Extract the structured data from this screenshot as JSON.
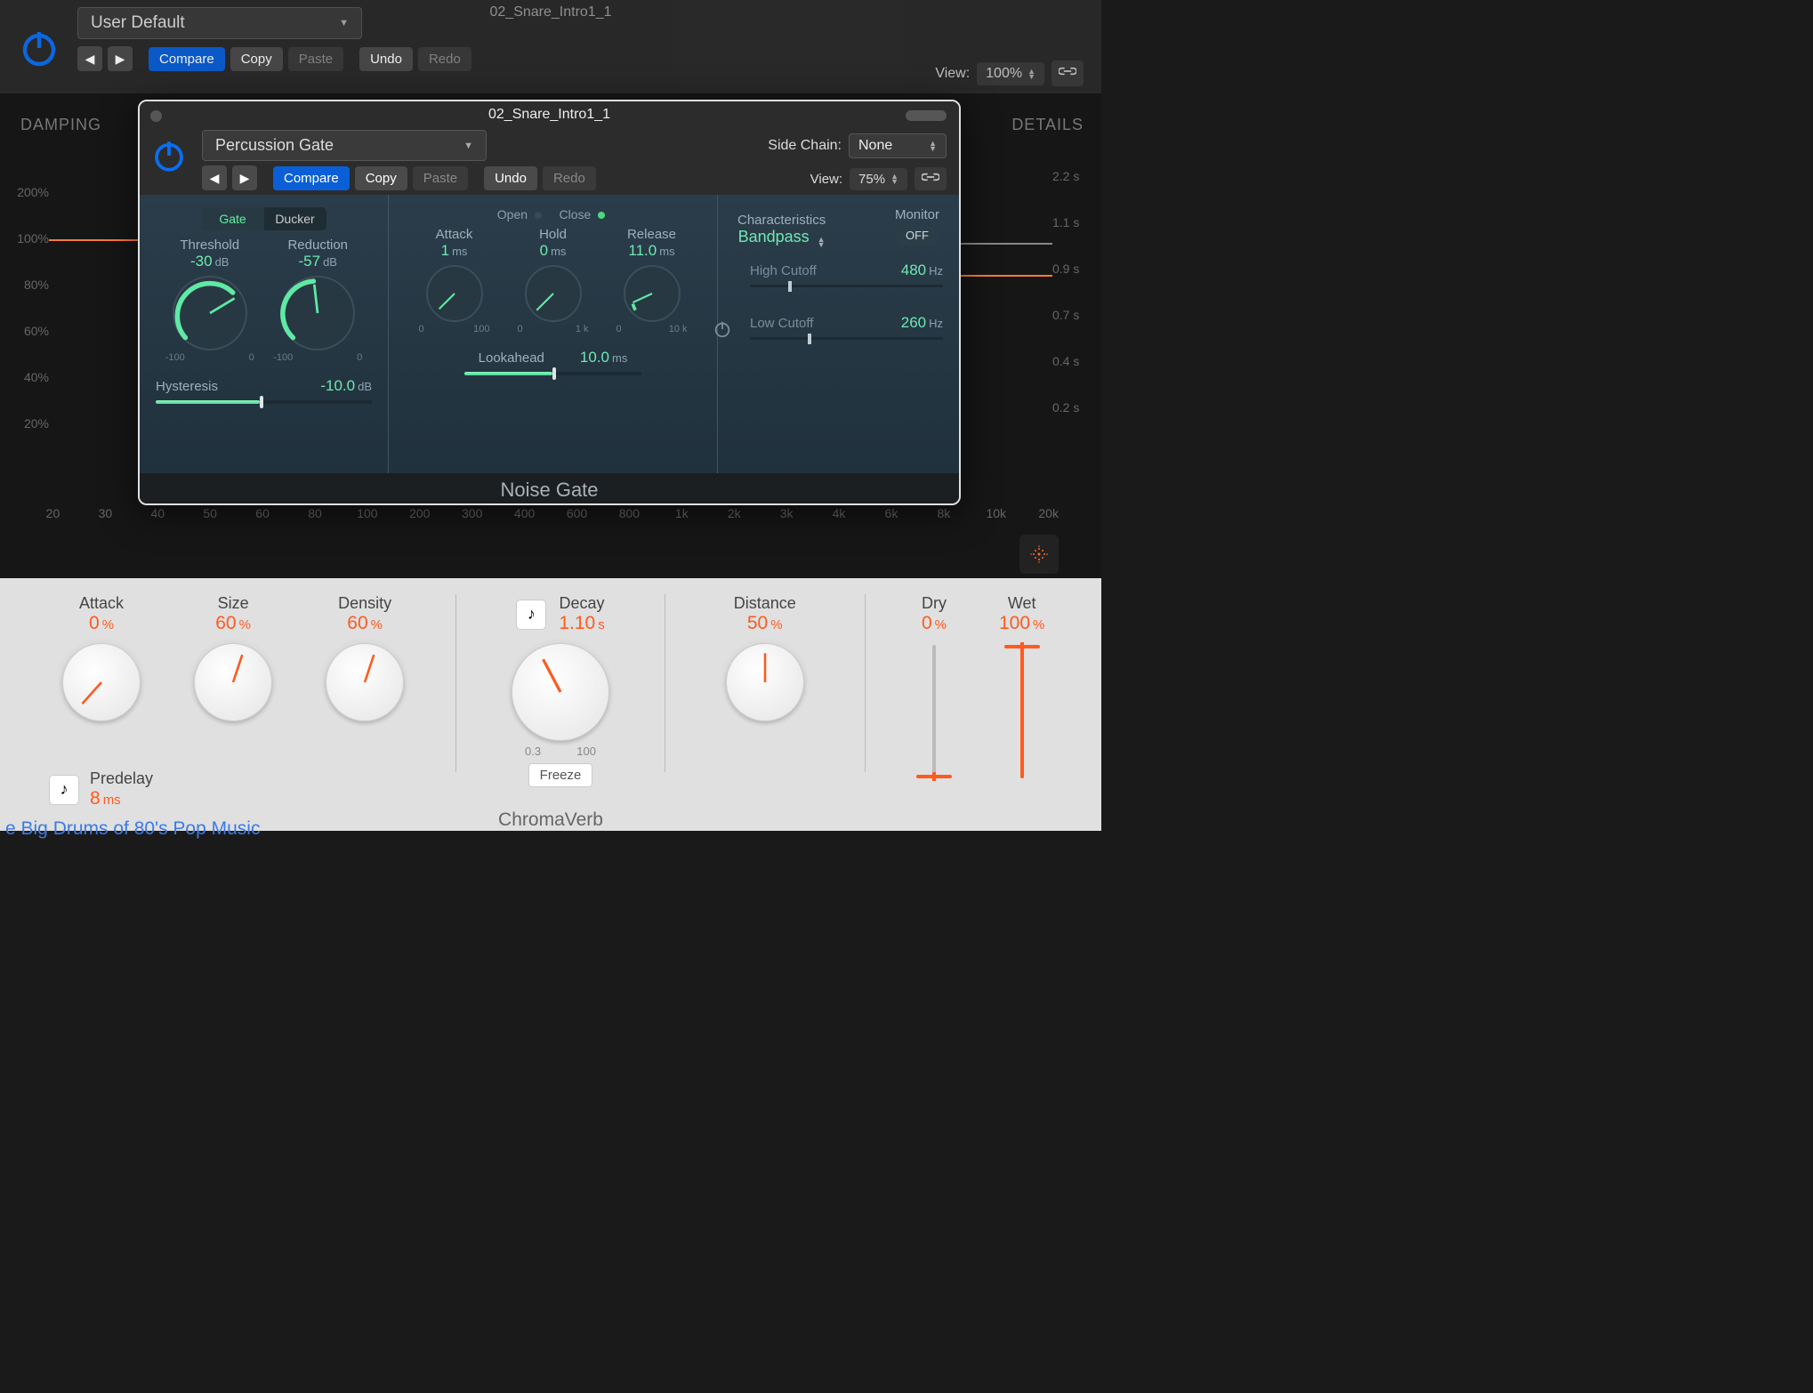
{
  "outer": {
    "tab_title": "02_Snare_Intro1_1",
    "preset": "User Default",
    "compare": "Compare",
    "copy": "Copy",
    "paste": "Paste",
    "undo": "Undo",
    "redo": "Redo",
    "view_label": "View:",
    "view_pct": "100%"
  },
  "graph": {
    "damping": "DAMPING",
    "details": "DETAILS",
    "y_left": [
      "200%",
      "100%",
      "80%",
      "60%",
      "40%",
      "20%"
    ],
    "y_right": [
      "2.2 s",
      "1.1 s",
      "0.9 s",
      "0.7 s",
      "0.4 s",
      "0.2 s"
    ],
    "x": [
      "20",
      "30",
      "40",
      "50",
      "60",
      "80",
      "100",
      "200",
      "300",
      "400",
      "600",
      "800",
      "1k",
      "2k",
      "3k",
      "4k",
      "6k",
      "8k",
      "10k",
      "20k"
    ]
  },
  "ng": {
    "title": "02_Snare_Intro1_1",
    "preset": "Percussion Gate",
    "sidechain_label": "Side Chain:",
    "sidechain_value": "None",
    "compare": "Compare",
    "copy": "Copy",
    "paste": "Paste",
    "undo": "Undo",
    "redo": "Redo",
    "view_label": "View:",
    "view_pct": "75%",
    "tabs": {
      "gate": "Gate",
      "ducker": "Ducker"
    },
    "open": "Open",
    "close": "Close",
    "threshold": {
      "label": "Threshold",
      "val": "-30",
      "unit": "dB",
      "lo": "-100",
      "hi": "0"
    },
    "reduction": {
      "label": "Reduction",
      "val": "-57",
      "unit": "dB",
      "lo": "-100",
      "hi": "0"
    },
    "attack": {
      "label": "Attack",
      "val": "1",
      "unit": "ms",
      "lo": "0",
      "hi": "100"
    },
    "hold": {
      "label": "Hold",
      "val": "0",
      "unit": "ms",
      "lo": "0",
      "hi": "1 k"
    },
    "release": {
      "label": "Release",
      "val": "11.0",
      "unit": "ms",
      "lo": "0",
      "hi": "10 k"
    },
    "hysteresis": {
      "label": "Hysteresis",
      "val": "-10.0",
      "unit": "dB"
    },
    "lookahead": {
      "label": "Lookahead",
      "val": "10.0",
      "unit": "ms"
    },
    "char_label": "Characteristics",
    "char_val": "Bandpass",
    "monitor_label": "Monitor",
    "monitor_val": "OFF",
    "highcut": {
      "label": "High Cutoff",
      "val": "480",
      "unit": "Hz"
    },
    "lowcut": {
      "label": "Low Cutoff",
      "val": "260",
      "unit": "Hz"
    },
    "foot": "Noise Gate"
  },
  "cv": {
    "attack": {
      "label": "Attack",
      "val": "0",
      "unit": "%"
    },
    "size": {
      "label": "Size",
      "val": "60",
      "unit": "%"
    },
    "density": {
      "label": "Density",
      "val": "60",
      "unit": "%"
    },
    "decay": {
      "label": "Decay",
      "val": "1.10",
      "unit": "s",
      "lo": "0.3",
      "hi": "100"
    },
    "distance": {
      "label": "Distance",
      "val": "50",
      "unit": "%"
    },
    "dry": {
      "label": "Dry",
      "val": "0",
      "unit": "%"
    },
    "wet": {
      "label": "Wet",
      "val": "100",
      "unit": "%"
    },
    "predelay": {
      "label": "Predelay",
      "val": "8",
      "unit": "ms"
    },
    "freeze": "Freeze",
    "title": "ChromaVerb"
  },
  "footer_link": "e Big Drums of 80's Pop Music"
}
